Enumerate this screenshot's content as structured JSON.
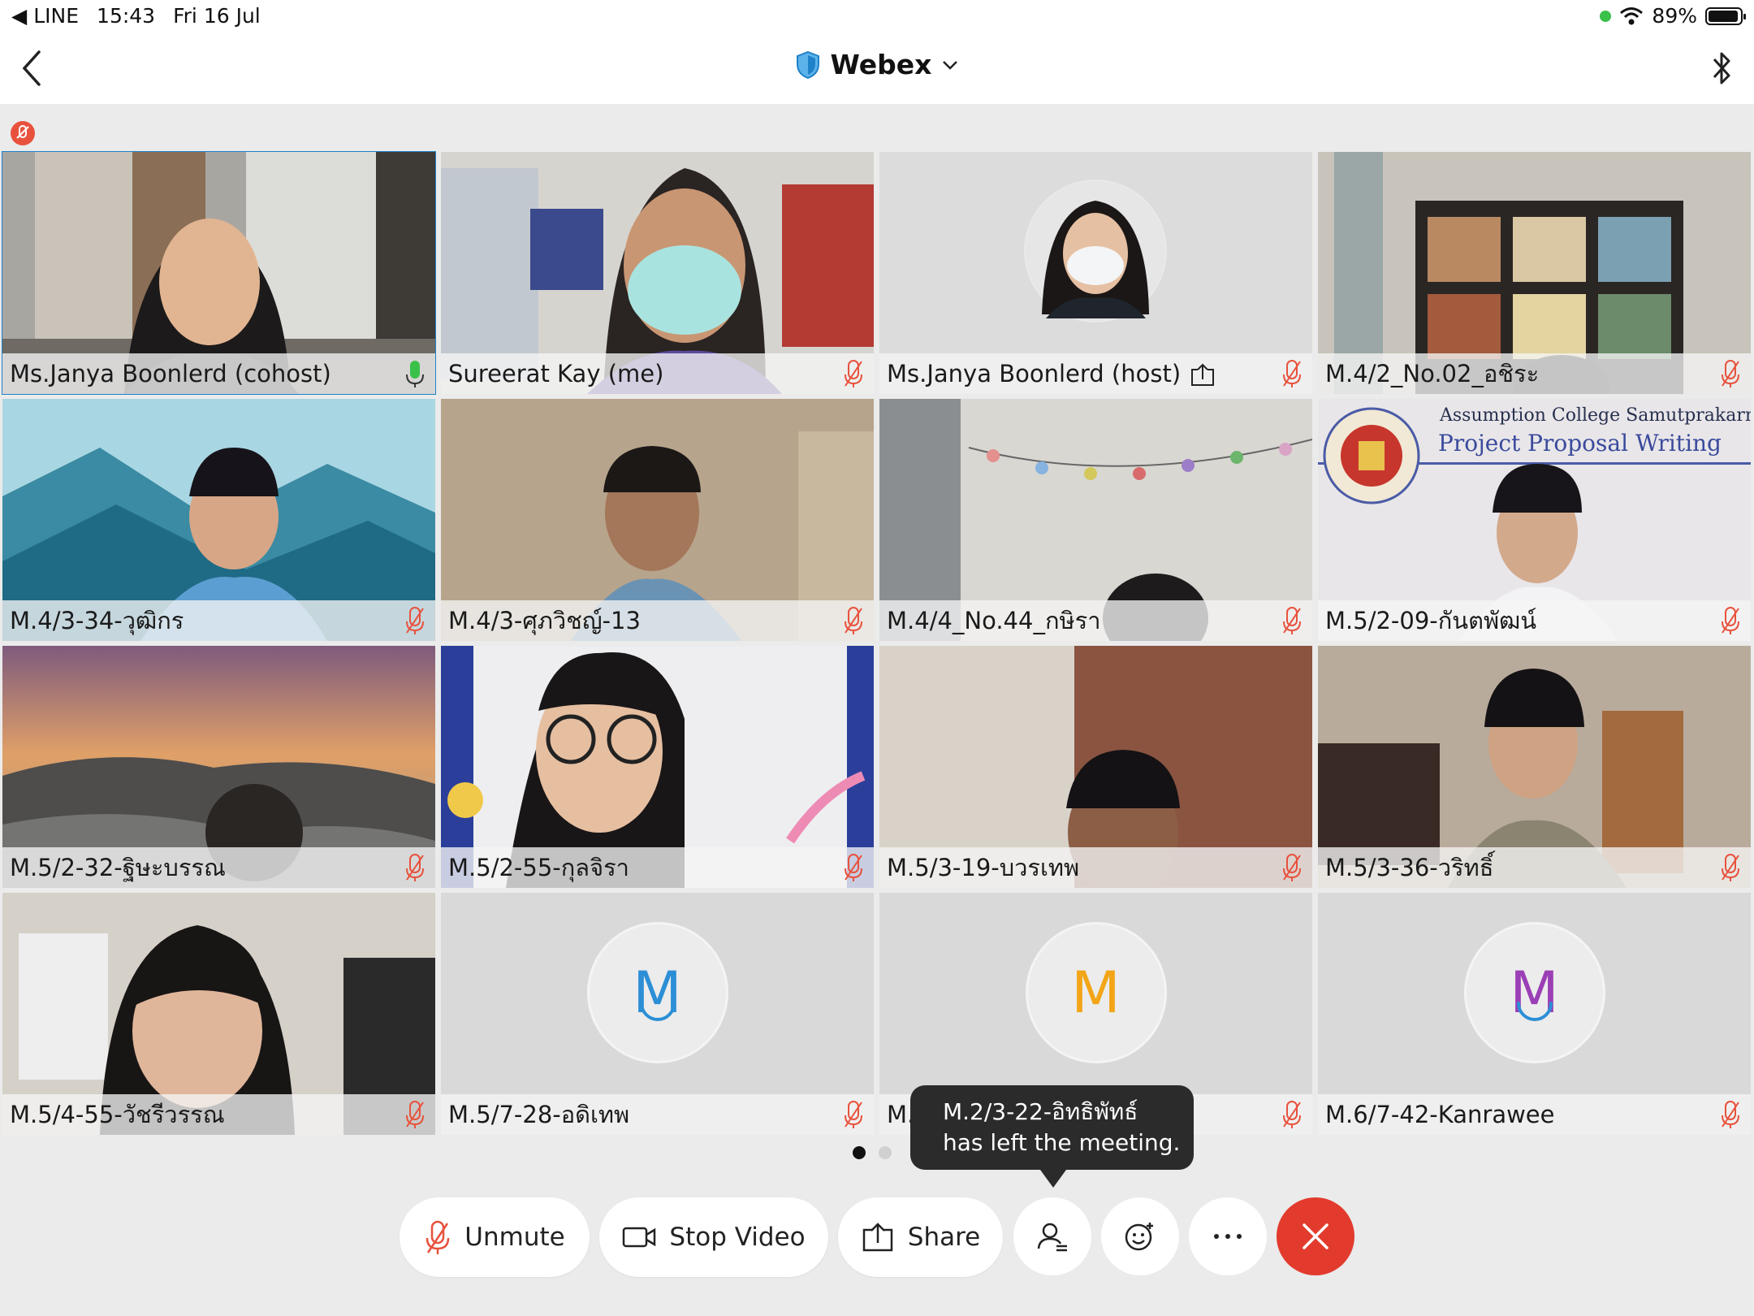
{
  "status_bar": {
    "back_app": "LINE",
    "time": "15:43",
    "date": "Fri 16 Jul",
    "battery": "89%"
  },
  "nav": {
    "title": "Webex"
  },
  "participants": [
    {
      "name": "Ms.Janya Boonlerd (cohost)",
      "mic": "unmuted",
      "active": true,
      "video": "on"
    },
    {
      "name": "Sureerat Kay (me)",
      "mic": "muted",
      "video": "on"
    },
    {
      "name": "Ms.Janya Boonlerd (host)",
      "mic": "muted",
      "video": "off",
      "sharing": true
    },
    {
      "name": "M.4/2_No.02_อชิระ",
      "mic": "muted",
      "video": "on"
    },
    {
      "name": "M.4/3-34-วุฒิกร",
      "mic": "muted",
      "video": "on"
    },
    {
      "name": "M.4/3-ศุภวิชญ์-13",
      "mic": "muted",
      "video": "on"
    },
    {
      "name": "M.4/4_No.44_กษิรา",
      "mic": "muted",
      "video": "on"
    },
    {
      "name": "M.5/2-09-กันตพัฒน์",
      "mic": "muted",
      "video": "on",
      "banner": {
        "line1": "Assumption College Samutprakarn",
        "line2": "Project Proposal Writing"
      }
    },
    {
      "name": "M.5/2-32-ฐิษะบรรณ",
      "mic": "muted",
      "video": "on"
    },
    {
      "name": "M.5/2-55-กุลจิรา",
      "mic": "muted",
      "video": "on"
    },
    {
      "name": "M.5/3-19-บวรเทพ",
      "mic": "muted",
      "video": "on"
    },
    {
      "name": "M.5/3-36-วริทธิ์",
      "mic": "muted",
      "video": "on"
    },
    {
      "name": "M.5/4-55-วัชรีวรรณ",
      "mic": "muted",
      "video": "on"
    },
    {
      "name": "M.5/7-28-อดิเทพ",
      "mic": "muted",
      "video": "off",
      "initial": "M",
      "initial_color": "#2c8fd6"
    },
    {
      "name": "M.6/",
      "mic": "muted",
      "video": "off",
      "initial": "M",
      "initial_color": "#f2a516"
    },
    {
      "name": "M.6/7-42-Kanrawee",
      "mic": "muted",
      "video": "off",
      "initial": "M",
      "initial_color": "#9b3fb6"
    }
  ],
  "pager": {
    "pages": 2,
    "current": 1
  },
  "toast": {
    "line1": "M.2/3-22-อิทธิพัทธ์",
    "line2": "has left the meeting."
  },
  "controls": {
    "unmute": "Unmute",
    "stop_video": "Stop Video",
    "share": "Share"
  },
  "colors": {
    "accent": "#1f81c9",
    "mute_red": "#e8523d",
    "end_red": "#e23b2e",
    "mic_green": "#3ac14a"
  }
}
